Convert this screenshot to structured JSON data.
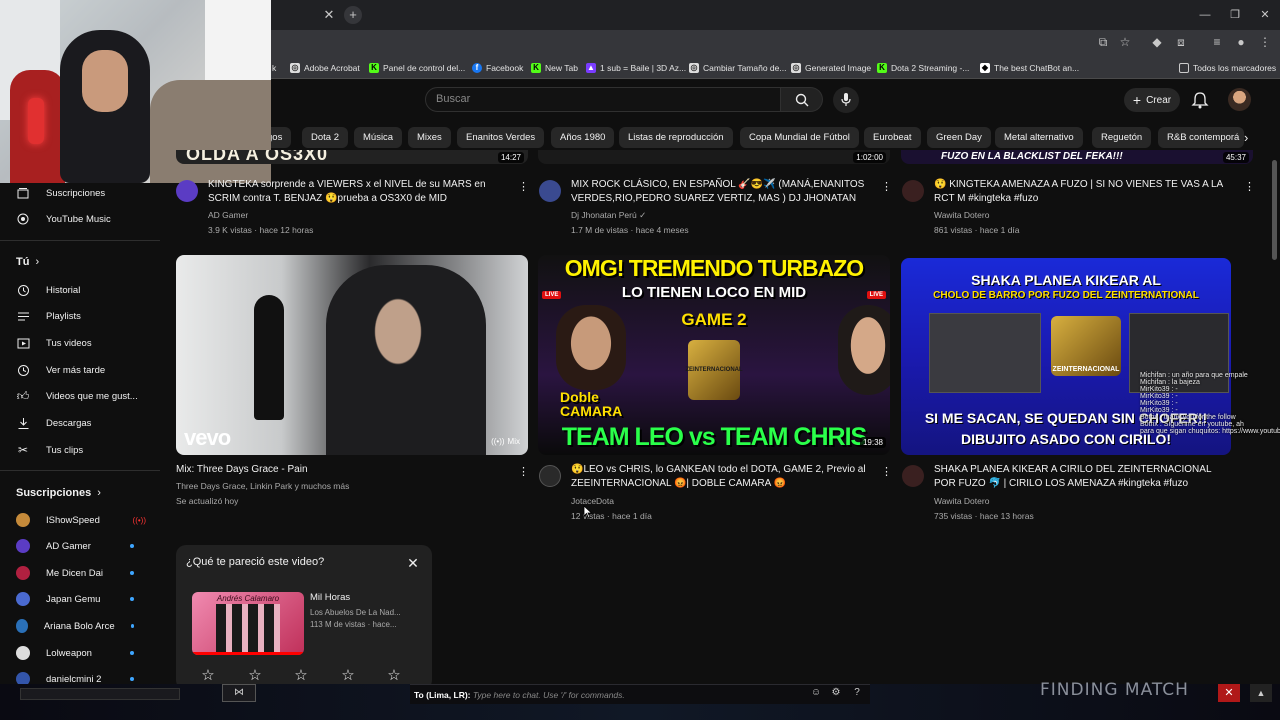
{
  "browser": {
    "bookmarks": [
      "k",
      "Adobe Acrobat",
      "Panel de control del...",
      "Facebook",
      "New Tab",
      "1 sub = Baile | 3D Az...",
      "Cambiar Tamaño de...",
      "Generated Image",
      "Dota 2 Streaming -...",
      "The best ChatBot an...",
      "Todos los marcadores"
    ]
  },
  "header": {
    "search_placeholder": "Buscar",
    "create_label": "Crear"
  },
  "chips": [
    "gos",
    "Dota 2",
    "Música",
    "Mixes",
    "Enanitos Verdes",
    "Años 1980",
    "Listas de reproducción",
    "Copa Mundial de Fútbol",
    "Eurobeat",
    "Green Day",
    "Metal alternativo",
    "Reguetón",
    "R&B contemporá"
  ],
  "sidebar": {
    "top_items": [
      "Suscripciones",
      "YouTube Music"
    ],
    "you_label": "Tú",
    "you_items": [
      "Historial",
      "Playlists",
      "Tus videos",
      "Ver más tarde",
      "Videos que me gust...",
      "Descargas",
      "Tus clips"
    ],
    "subs_label": "Suscripciones",
    "subs": [
      "IShowSpeed",
      "AD Gamer",
      "Me Dicen Dai",
      "Japan Gemu",
      "Ariana Bolo Arce",
      "Lolweapon",
      "danielcmini 2"
    ]
  },
  "row1": [
    {
      "title_1": "KINGTEKA sorprende a VIEWERS x el NIVEL de su MARS en",
      "title_2": "SCRIM contra T. BENJAZ 😲prueba a OS3X0 de MID",
      "channel": "AD Gamer",
      "meta": "3.9 K vistas · hace 12 horas",
      "thumb_text": "OLDA A OS3X0",
      "duration": "14:27"
    },
    {
      "title_1": "MIX ROCK CLÁSICO, EN ESPAÑOL 🎸😎✈️ (MANÁ,ENANITOS",
      "title_2": "VERDES,RIO,PEDRO SUAREZ VERTIZ, MAS ) DJ JHONATAN",
      "channel": "Dj Jhonatan Perú",
      "meta": "1.7 M de vistas · hace 4 meses",
      "thumb_text": "",
      "duration": "1:02:00"
    },
    {
      "title_1": "😲 KINGTEKA AMENAZA A FUZO | SI NO VIENES TE VAS A LA",
      "title_2": "RCT M      #kingteka #fuzo",
      "channel": "Wawita Dotero",
      "meta": "861 vistas · hace 1 día",
      "thumb_text": "FUZO EN LA BLACKLIST DEL FEKA!!!",
      "duration": "45:37"
    }
  ],
  "row2": [
    {
      "title_1": "Mix: Three Days Grace - Pain",
      "title_2": "",
      "channel": "Three Days Grace, Linkin Park y muchos más",
      "meta": "Se actualizó hoy",
      "thumb_logo": "vevo",
      "badge": "Mix"
    },
    {
      "title_1": "😲LEO vs CHRIS, lo GANKEAN todo el DOTA, GAME 2, Previo al",
      "title_2": "ZEEINTERNACIONAL 😡| DOBLE CAMARA 😡",
      "channel": "JotaceDota",
      "meta": "12 vistas · hace 1 día",
      "thumb_line1": "OMG! TREMENDO TURBAZO",
      "thumb_line2": "LO TIENEN LOCO EN MID",
      "thumb_line3": "GAME 2",
      "thumb_line4": "TEAM LEO vs TEAM CHRIS",
      "thumb_side": "Doble CAMARA",
      "live1": "LIVE",
      "live2": "LIVE",
      "thumb_seal": "ZEINTERNACIONAL",
      "duration": "19:38"
    },
    {
      "title_1": "SHAKA PLANEA KIKEAR A CIRILO DEL ZEINTERNACIONAL",
      "title_2": "POR FUZO 🐬 | CIRILO LOS AMENAZA  #kingteka #fuzo",
      "channel": "Wawita Dotero",
      "meta": "735 vistas · hace 13 horas",
      "thumb_line1": "SHAKA PLANEA KIKEAR AL",
      "thumb_line2": "CHOLO DE BARRO POR FUZO DEL ZEINTERNATIONAL",
      "thumb_line3": "SI ME SACAN, SE QUEDAN SIN CHOFER!!",
      "thumb_line4": "DIBUJITO ASADO CON CIRILO!",
      "thumb_seal": "ZEINTERNACIONAL"
    }
  ],
  "feedback": {
    "question": "¿Qué te pareció este video?",
    "song_title": "Mil Horas",
    "song_artist": "Los Abuelos De La Nad...",
    "song_meta": "113 M de vistas · hace...",
    "thumb_text": "Andrés Calamaro"
  },
  "game": {
    "chat_prefix": "To (Lima, LR):",
    "chat_placeholder": "Type here to chat. Use '/' for commands.",
    "status": "FINDING MATCH"
  },
  "overlay_chat": [
    "Michifan : un año para que empale",
    "Michifan : la bajeza",
    "MirKito39 : -",
    "MirKito39 : -",
    "MirKito39 : -",
    "MirKito39 : -",
    "Botrix : thank you for the follow",
    "Botrix : Síguenme en youtube, ah",
    "para que sigan chuquitos: https://www.youtube."
  ]
}
